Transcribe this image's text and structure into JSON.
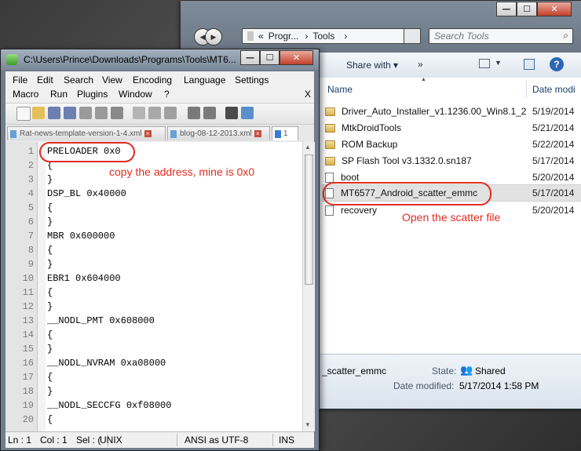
{
  "explorer": {
    "address": {
      "parts": [
        "«",
        "Progr...",
        "›",
        "Tools",
        "›"
      ]
    },
    "search_placeholder": "Search Tools",
    "toolbar": {
      "share_with": "Share with ▾",
      "more": "»"
    },
    "columns": {
      "name": "Name",
      "date": "Date modi"
    },
    "items": [
      {
        "name": "Driver_Auto_Installer_v1.1236.00_Win8.1_2",
        "date": "5/19/2014",
        "type": "folder"
      },
      {
        "name": "MtkDroidTools",
        "date": "5/21/2014",
        "type": "folder"
      },
      {
        "name": "ROM Backup",
        "date": "5/22/2014",
        "type": "folder"
      },
      {
        "name": "SP Flash Tool v3.1332.0.sn187",
        "date": "5/17/2014",
        "type": "folder"
      },
      {
        "name": "boot",
        "date": "5/20/2014",
        "type": "file"
      },
      {
        "name": "MT6577_Android_scatter_emmc",
        "date": "5/17/2014",
        "type": "file"
      },
      {
        "name": "recovery",
        "date": "5/20/2014",
        "type": "file"
      }
    ],
    "details": {
      "filename": "_scatter_emmc",
      "state_label": "State:",
      "state_value": "Shared",
      "modified_label": "Date modified:",
      "modified_value": "5/17/2014 1:58 PM"
    }
  },
  "npp": {
    "title": "C:\\Users\\Prince\\Downloads\\Programs\\Tools\\MT6...",
    "menu_row1": [
      "File",
      "Edit",
      "Search",
      "View",
      "Encoding",
      "Language",
      "Settings"
    ],
    "menu_row2": [
      "Macro",
      "Run",
      "Plugins",
      "Window",
      "?"
    ],
    "menu_close": "X",
    "tabs": [
      "Rat-news-template-version-1-4.xml",
      "blog-08-12-2013.xml",
      "1"
    ],
    "lines": [
      "PRELOADER 0x0",
      "{",
      "}",
      "DSP_BL 0x40000",
      "{",
      "}",
      "MBR 0x600000",
      "{",
      "}",
      "EBR1 0x604000",
      "{",
      "}",
      "__NODL_PMT 0x608000",
      "{",
      "}",
      "__NODL_NVRAM 0xa08000",
      "{",
      "}",
      "__NODL_SECCFG 0xf08000",
      "{"
    ],
    "line_numbers": [
      "1",
      "2",
      "3",
      "4",
      "5",
      "6",
      "7",
      "8",
      "9",
      "10",
      "11",
      "12",
      "13",
      "14",
      "15",
      "16",
      "17",
      "18",
      "19",
      "20"
    ],
    "status": {
      "ln": "Ln : 1",
      "col": "Col : 1",
      "sel": "Sel : (",
      "eol": "UNIX",
      "enc": "ANSI as UTF-8",
      "ins": "INS"
    }
  },
  "annotations": {
    "copy_address": "copy the address, mine is 0x0",
    "open_scatter": "Open the scatter file"
  },
  "colors": {
    "annotation": "#e02c20",
    "explorer_header_text": "#1e3c6b"
  }
}
